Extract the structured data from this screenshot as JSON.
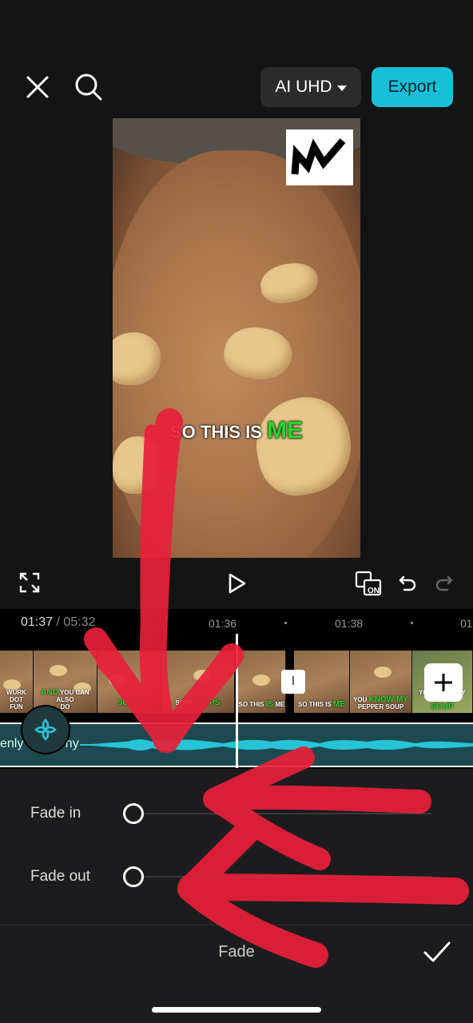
{
  "header": {
    "quality_label": "AI UHD",
    "export_label": "Export"
  },
  "preview": {
    "caption_prefix": "SO THIS IS ",
    "caption_highlight": "ME"
  },
  "controls": {
    "current_time": "01:37",
    "separator": "/",
    "total_time": "05:32",
    "sync_badge": "ON"
  },
  "timeline": {
    "ruler_labels": [
      "01:36",
      "01:38",
      "01"
    ],
    "transition_glyph": "I",
    "clips": [
      {
        "text": "WURK DOT",
        "text2": "FUN",
        "highlight": ""
      },
      {
        "text": "YOU CAN ALSO",
        "text2": "DO",
        "highlight": "AND"
      },
      {
        "text": "",
        "text2": "",
        "highlight": "SOME"
      },
      {
        "text": "SOME",
        "text2": "",
        "highlight": "S/APS"
      },
      {
        "text": "SO THIS",
        "text2": "ME",
        "highlight": "IS"
      },
      {
        "text": "SO THIS IS",
        "text2": "",
        "highlight": "ME"
      },
      {
        "text": "YOU",
        "text2": "PEPPER SOUP",
        "highlight": "KNOW MY"
      },
      {
        "text": "YOU KNOW MY PEPPER",
        "text2": "",
        "highlight": "SOUP"
      }
    ],
    "audio_track_name": "enly Harmony"
  },
  "panel": {
    "fade_in_label": "Fade in",
    "fade_out_label": "Fade out",
    "fade_in_value": 0,
    "fade_out_value": 0,
    "title": "Fade"
  },
  "colors": {
    "accent": "#16c0d8",
    "caption_highlight": "#2bd52b",
    "audio_track": "#1d4a50",
    "scribble": "#e8203a"
  },
  "icons": [
    "close-icon",
    "search-icon",
    "fullscreen-icon",
    "play-icon",
    "sync-icon",
    "undo-icon",
    "redo-icon",
    "add-icon",
    "audio-fx-icon",
    "checkmark-icon"
  ]
}
